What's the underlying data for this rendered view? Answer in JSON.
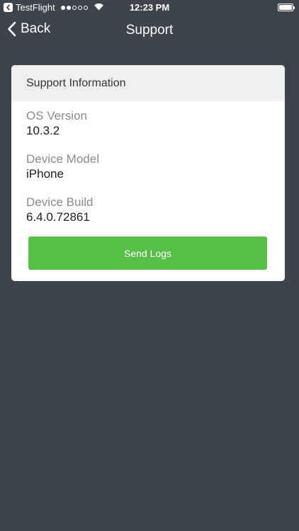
{
  "status_bar": {
    "app_name": "TestFlight",
    "time": "12:23 PM",
    "signal": {
      "filled": 2,
      "total": 5
    }
  },
  "nav": {
    "back_label": "Back",
    "title": "Support"
  },
  "card": {
    "header": "Support Information",
    "items": [
      {
        "label": "OS Version",
        "value": "10.3.2"
      },
      {
        "label": "Device Model",
        "value": "iPhone"
      },
      {
        "label": "Device Build",
        "value": "6.4.0.72861"
      }
    ],
    "button_label": "Send Logs"
  },
  "icons": {
    "back": "chevron-left-icon",
    "wifi": "wifi-icon",
    "battery": "battery-icon"
  },
  "colors": {
    "background": "#3e444c",
    "card": "#ffffff",
    "card_header": "#efefef",
    "button": "#57be48",
    "label": "#8a8a8a",
    "value": "#222222"
  }
}
